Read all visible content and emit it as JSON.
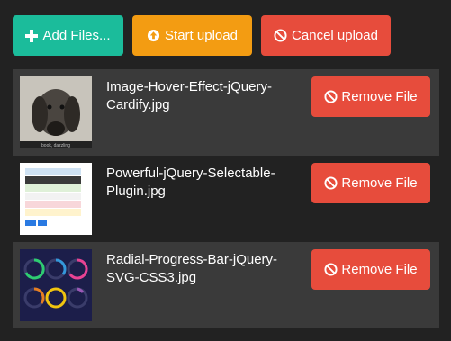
{
  "toolbar": {
    "add_label": "Add Files...",
    "start_label": "Start upload",
    "cancel_label": "Cancel upload"
  },
  "files": [
    {
      "name": "Image-Hover-Effect-jQuery-Cardify.jpg",
      "remove_label": "Remove File",
      "thumb_icon": "dog-photo",
      "thumb_caption": "book, dazzling"
    },
    {
      "name": "Powerful-jQuery-Selectable-Plugin.jpg",
      "remove_label": "Remove File",
      "thumb_icon": "list-group-screenshot"
    },
    {
      "name": "Radial-Progress-Bar-jQuery-SVG-CSS3.jpg",
      "remove_label": "Remove File",
      "thumb_icon": "radial-progress-screenshot"
    }
  ],
  "colors": {
    "background": "#222222",
    "row_alt": "#3a3a3a",
    "add": "#1bbc9b",
    "start": "#f39c12",
    "danger": "#e74c3c"
  }
}
